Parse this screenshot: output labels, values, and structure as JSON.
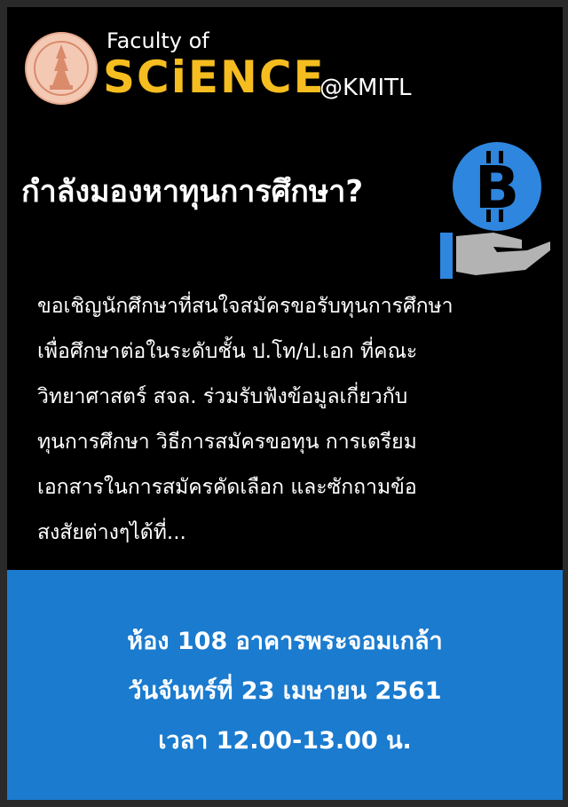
{
  "brand": {
    "faculty": "Faculty of",
    "science": "SCiENCE",
    "at": "@KMITL"
  },
  "headline": "กำลังมองหาทุนการศึกษา?",
  "icon": {
    "name": "bitcoin-in-hand-icon",
    "color": "#2e86de"
  },
  "body_lines": [
    "ขอเชิญนักศึกษาที่สนใจสมัครขอรับทุนการศึกษา",
    "เพื่อศึกษาต่อในระดับชั้น   ป.โท/ป.เอก   ที่คณะ",
    "วิทยาศาสตร์ สจล. ร่วมรับฟังข้อมูลเกี่ยวกับ",
    "ทุนการศึกษา วิธีการสมัครขอทุน การเตรียม",
    "เอกสารในการสมัครคัดเลือก และซักถามข้อ",
    "สงสัยต่างๆได้ที่..."
  ],
  "event": {
    "room": "ห้อง 108 อาคารพระจอมเกล้า",
    "date": "วันจันทร์ที่ 23 เมษายน 2561",
    "time": "เวลา 12.00-13.00 น."
  },
  "colors": {
    "background": "#000000",
    "science_yellow": "#f5bd1f",
    "info_blue": "#1a7bcf",
    "text": "#ffffff"
  }
}
